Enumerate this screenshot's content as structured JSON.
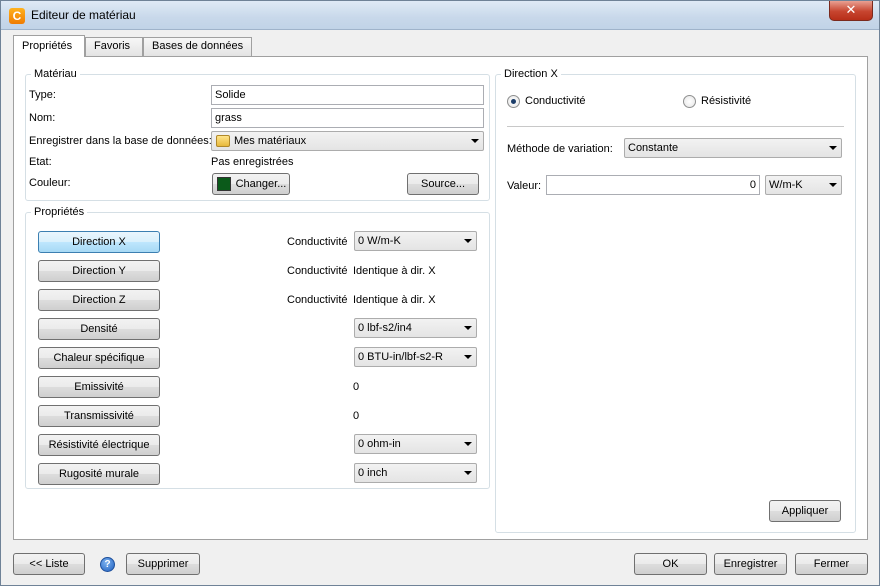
{
  "window": {
    "title": "Editeur de matériau",
    "close_glyph": "✕",
    "app_icon_letter": "C"
  },
  "tabs": [
    {
      "label": "Propriétés",
      "active": true
    },
    {
      "label": "Favoris",
      "active": false
    },
    {
      "label": "Bases de données",
      "active": false
    }
  ],
  "material": {
    "legend": "Matériau",
    "type_label": "Type:",
    "type_value": "Solide",
    "name_label": "Nom:",
    "name_value": "grass",
    "save_db_label": "Enregistrer dans la base de données:",
    "save_db_value": "Mes matériaux",
    "state_label": "Etat:",
    "state_value": "Pas enregistrées",
    "color_label": "Couleur:",
    "color_swatch": "#0b5a1a",
    "change_button": "Changer...",
    "source_button": "Source..."
  },
  "properties": {
    "legend": "Propriétés",
    "rows": [
      {
        "button": "Direction X",
        "selected": true,
        "caption": "Conductivité",
        "kind": "combo",
        "value": "0 W/m-K"
      },
      {
        "button": "Direction Y",
        "selected": false,
        "caption": "Conductivité",
        "kind": "text",
        "value": "Identique à dir. X"
      },
      {
        "button": "Direction Z",
        "selected": false,
        "caption": "Conductivité",
        "kind": "text",
        "value": "Identique à dir. X"
      },
      {
        "button": "Densité",
        "selected": false,
        "caption": "",
        "kind": "combo",
        "value": "0 lbf-s2/in4"
      },
      {
        "button": "Chaleur spécifique",
        "selected": false,
        "caption": "",
        "kind": "combo",
        "value": "0 BTU-in/lbf-s2-R"
      },
      {
        "button": "Emissivité",
        "selected": false,
        "caption": "",
        "kind": "text",
        "value": "0"
      },
      {
        "button": "Transmissivité",
        "selected": false,
        "caption": "",
        "kind": "text",
        "value": "0"
      },
      {
        "button": "Résistivité électrique",
        "selected": false,
        "caption": "",
        "kind": "combo",
        "value": "0 ohm-in"
      },
      {
        "button": "Rugosité murale",
        "selected": false,
        "caption": "",
        "kind": "combo",
        "value": "0 inch"
      }
    ]
  },
  "direction": {
    "legend": "Direction X",
    "radio_conductivity": "Conductivité",
    "radio_resistivity": "Résistivité",
    "method_label": "Méthode de variation:",
    "method_value": "Constante",
    "value_label": "Valeur:",
    "value_input": "0",
    "unit_value": "W/m-K",
    "apply_button": "Appliquer"
  },
  "footer": {
    "list_button": "<< Liste",
    "help_glyph": "?",
    "delete_button": "Supprimer",
    "ok_button": "OK",
    "save_button": "Enregistrer",
    "close_button": "Fermer"
  },
  "colors": {
    "titlebar": "#c8d8ea",
    "selected_button": "#bee6fd",
    "swatch": "#0b5a1a"
  }
}
